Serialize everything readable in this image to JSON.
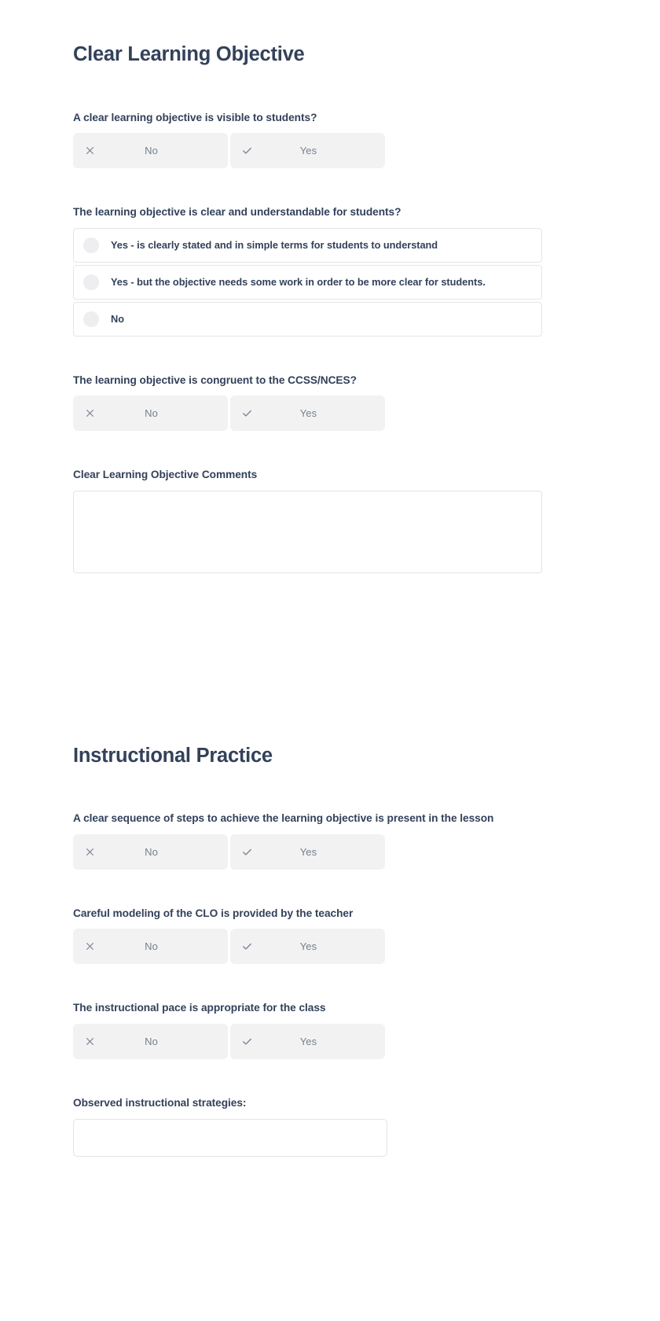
{
  "sections": [
    {
      "id": "clear-learning-objective",
      "title": "Clear Learning Objective",
      "fields": [
        {
          "type": "toggle",
          "label": "A clear learning objective is visible to students?",
          "options": [
            {
              "icon": "x-icon",
              "label": "No"
            },
            {
              "icon": "check-icon",
              "label": "Yes"
            }
          ]
        },
        {
          "type": "radio",
          "label": "The learning objective is clear and understandable for students?",
          "options": [
            {
              "label": "Yes - is clearly stated and in simple terms for students to understand"
            },
            {
              "label": "Yes - but the objective needs some work in order to be more clear for students."
            },
            {
              "label": "No"
            }
          ]
        },
        {
          "type": "toggle",
          "label": "The learning objective is congruent to the CCSS/NCES?",
          "options": [
            {
              "icon": "x-icon",
              "label": "No"
            },
            {
              "icon": "check-icon",
              "label": "Yes"
            }
          ]
        },
        {
          "type": "textarea",
          "label": "Clear Learning Objective Comments",
          "value": "",
          "placeholder": ""
        }
      ]
    },
    {
      "id": "instructional-practice",
      "title": "Instructional Practice",
      "fields": [
        {
          "type": "toggle",
          "label": "A clear sequence of steps to achieve the learning objective is present in the lesson",
          "options": [
            {
              "icon": "x-icon",
              "label": "No"
            },
            {
              "icon": "check-icon",
              "label": "Yes"
            }
          ]
        },
        {
          "type": "toggle",
          "label": "Careful modeling of the CLO is provided by the teacher",
          "options": [
            {
              "icon": "x-icon",
              "label": "No"
            },
            {
              "icon": "check-icon",
              "label": "Yes"
            }
          ]
        },
        {
          "type": "toggle",
          "label": "The instructional pace is appropriate for the class",
          "options": [
            {
              "icon": "x-icon",
              "label": "No"
            },
            {
              "icon": "check-icon",
              "label": "Yes"
            }
          ]
        },
        {
          "type": "clipped",
          "label": "Observed instructional strategies:"
        }
      ]
    }
  ],
  "colors": {
    "heading": "#33415a",
    "toggle_background": "#f2f2f3",
    "toggle_text": "#76808f",
    "card_border": "#e6e6e8",
    "radio_dot": "#eeeef0",
    "page_background": "#ffffff"
  }
}
